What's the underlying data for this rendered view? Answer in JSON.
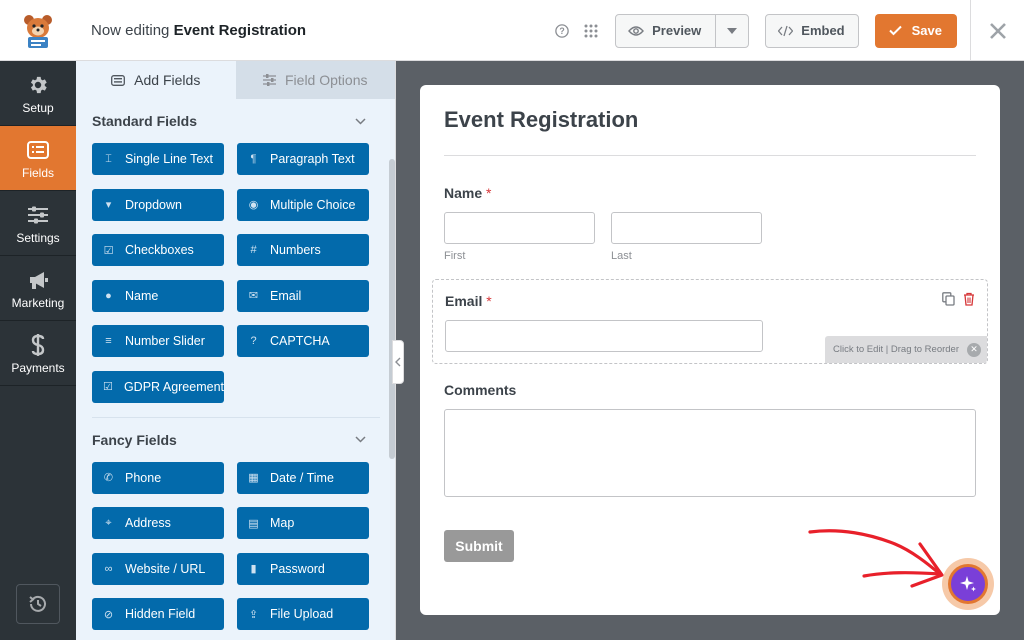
{
  "header": {
    "editing_prefix": "Now editing",
    "form_name": "Event Registration",
    "preview_label": "Preview",
    "embed_label": "Embed",
    "save_label": "Save",
    "icons": [
      "help-icon",
      "grid-icon",
      "eye-icon",
      "chevron-down-icon",
      "code-icon",
      "check-icon",
      "close-icon"
    ]
  },
  "sidebar": {
    "items": [
      {
        "label": "Setup",
        "icon": "gear-icon",
        "active": false
      },
      {
        "label": "Fields",
        "icon": "list-icon",
        "active": true
      },
      {
        "label": "Settings",
        "icon": "sliders-icon",
        "active": false
      },
      {
        "label": "Marketing",
        "icon": "megaphone-icon",
        "active": false
      },
      {
        "label": "Payments",
        "icon": "dollar-icon",
        "active": false
      }
    ],
    "bottom_icon": "history-icon"
  },
  "panel": {
    "tabs": [
      {
        "label": "Add Fields",
        "active": true
      },
      {
        "label": "Field Options",
        "active": false
      }
    ],
    "standard_title": "Standard Fields",
    "standard_fields": [
      {
        "label": "Single Line Text",
        "icon": "text-cursor-icon",
        "glyph": "⌶"
      },
      {
        "label": "Paragraph Text",
        "icon": "paragraph-icon",
        "glyph": "¶"
      },
      {
        "label": "Dropdown",
        "icon": "dropdown-icon",
        "glyph": "▾"
      },
      {
        "label": "Multiple Choice",
        "icon": "radio-icon",
        "glyph": "◉"
      },
      {
        "label": "Checkboxes",
        "icon": "checkbox-icon",
        "glyph": "☑"
      },
      {
        "label": "Numbers",
        "icon": "hash-icon",
        "glyph": "#"
      },
      {
        "label": "Name",
        "icon": "user-icon",
        "glyph": "●"
      },
      {
        "label": "Email",
        "icon": "envelope-icon",
        "glyph": "✉"
      },
      {
        "label": "Number Slider",
        "icon": "slider-icon",
        "glyph": "≡"
      },
      {
        "label": "CAPTCHA",
        "icon": "question-circle-icon",
        "glyph": "?"
      },
      {
        "label": "GDPR Agreement",
        "icon": "checkbox-icon",
        "glyph": "☑"
      }
    ],
    "fancy_title": "Fancy Fields",
    "fancy_fields": [
      {
        "label": "Phone",
        "icon": "phone-icon",
        "glyph": "✆"
      },
      {
        "label": "Date / Time",
        "icon": "calendar-icon",
        "glyph": "▦"
      },
      {
        "label": "Address",
        "icon": "map-pin-icon",
        "glyph": "⌖"
      },
      {
        "label": "Map",
        "icon": "map-icon",
        "glyph": "▤"
      },
      {
        "label": "Website / URL",
        "icon": "link-icon",
        "glyph": "∞"
      },
      {
        "label": "Password",
        "icon": "lock-icon",
        "glyph": "▮"
      },
      {
        "label": "Hidden Field",
        "icon": "eye-slash-icon",
        "glyph": "⊘"
      },
      {
        "label": "File Upload",
        "icon": "upload-icon",
        "glyph": "⇪"
      }
    ]
  },
  "form": {
    "title": "Event Registration",
    "name_label": "Name",
    "name_first_sublabel": "First",
    "name_last_sublabel": "Last",
    "email_label": "Email",
    "required_mark": "*",
    "edit_hint": "Click to Edit | Drag to Reorder",
    "comments_label": "Comments",
    "submit_label": "Submit"
  },
  "colors": {
    "accent": "#e27730",
    "field_button": "#036aab",
    "sidebar_bg": "#2c3338",
    "ai_button": "#7a3fd8",
    "annotation_arrow": "#e8202a"
  }
}
